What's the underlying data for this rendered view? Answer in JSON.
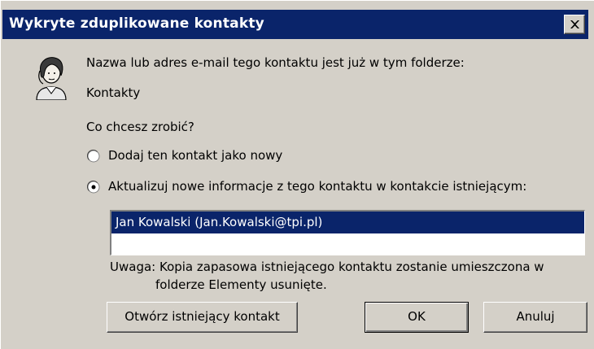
{
  "window": {
    "title": "Wykryte zduplikowane kontakty",
    "close_symbol": "×"
  },
  "message": {
    "line1": "Nazwa lub adres e-mail tego kontaktu jest już w tym folderze:",
    "folder": "Kontakty",
    "question": "Co chcesz zrobić?"
  },
  "options": [
    {
      "label": "Dodaj ten kontakt jako nowy",
      "selected": false
    },
    {
      "label": "Aktualizuj nowe informacje z tego kontaktu w kontakcie istniejącym:",
      "selected": true
    }
  ],
  "contact_list": {
    "items": [
      "Jan Kowalski (Jan.Kowalski@tpi.pl)"
    ]
  },
  "note": {
    "line1": "Uwaga: Kopia zapasowa istniejącego kontaktu zostanie umieszczona w",
    "line2": "folderze Elementy usunięte."
  },
  "buttons": {
    "open_existing": "Otwórz istniejący kontakt",
    "ok": "OK",
    "cancel": "Anuluj"
  },
  "colors": {
    "titlebar": "#0a246a",
    "dialog_bg": "#d4d0c8",
    "selection": "#0a246a"
  },
  "icons": {
    "avatar": "contact-person-icon",
    "close": "close-icon",
    "radio_off": "radio-unchecked-icon",
    "radio_on": "radio-checked-icon"
  }
}
